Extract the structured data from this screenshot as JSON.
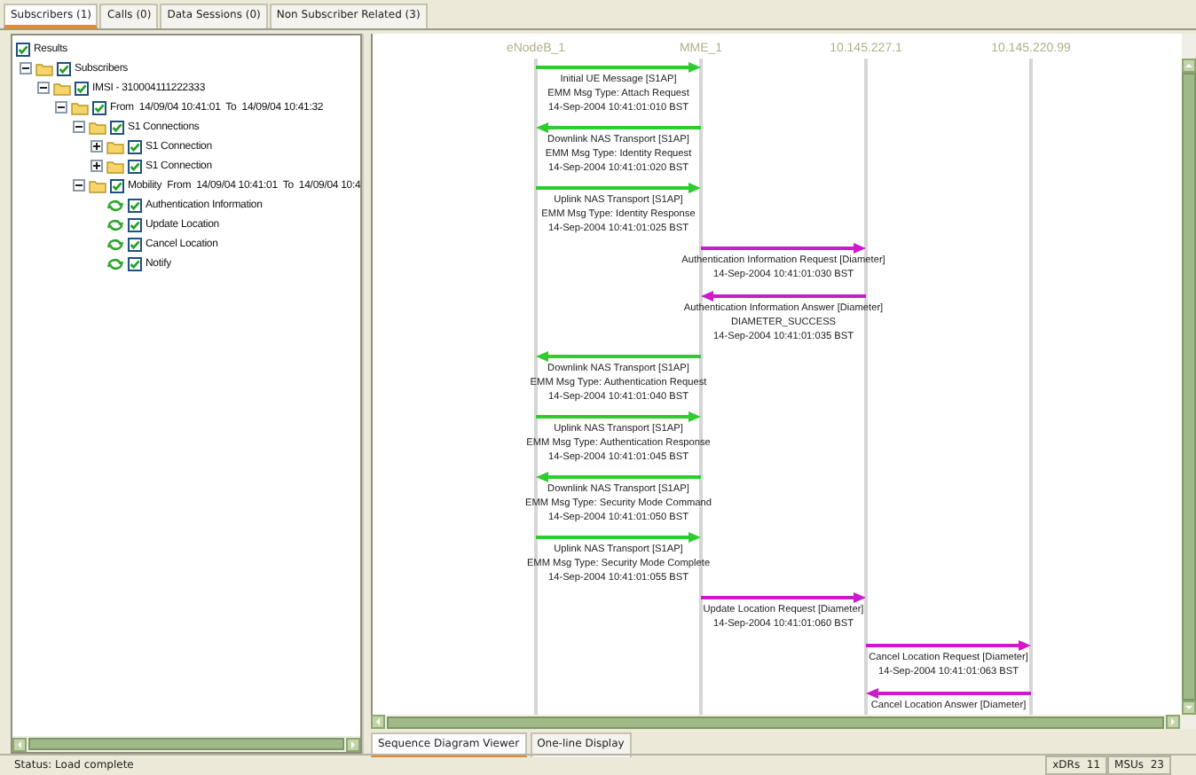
{
  "tabs": [
    {
      "label": "Subscribers (1)",
      "selected": true
    },
    {
      "label": "Calls (0)",
      "selected": false
    },
    {
      "label": "Data Sessions (0)",
      "selected": false
    },
    {
      "label": "Non Subscriber Related (3)",
      "selected": false
    }
  ],
  "tree": [
    {
      "label": "Results",
      "checked": true,
      "children": [
        {
          "label": "Subscribers",
          "kind": "folder",
          "checked": true,
          "expanded": true,
          "children": [
            {
              "label": "IMSI - 310004111222333",
              "kind": "folder",
              "checked": true,
              "expanded": true,
              "children": [
                {
                  "label": "From  14/09/04 10:41:01  To  14/09/04 10:41:32",
                  "kind": "folder",
                  "checked": true,
                  "expanded": true,
                  "children": [
                    {
                      "label": "S1 Connections",
                      "kind": "folder",
                      "checked": true,
                      "expanded": true,
                      "children": [
                        {
                          "label": "S1 Connection",
                          "kind": "folder",
                          "checked": true,
                          "expanded": false
                        },
                        {
                          "label": "S1 Connection",
                          "kind": "folder",
                          "checked": true,
                          "expanded": false
                        }
                      ]
                    },
                    {
                      "label": "Mobility  From  14/09/04 10:41:01  To  14/09/04 10:4",
                      "kind": "folder",
                      "checked": true,
                      "expanded": true,
                      "children": [
                        {
                          "label": "Authentication Information",
                          "kind": "procedure",
                          "checked": true
                        },
                        {
                          "label": "Update Location",
                          "kind": "procedure",
                          "checked": true
                        },
                        {
                          "label": "Cancel Location",
                          "kind": "procedure",
                          "checked": true
                        },
                        {
                          "label": "Notify",
                          "kind": "procedure",
                          "checked": true
                        }
                      ]
                    }
                  ]
                }
              ]
            }
          ]
        }
      ]
    }
  ],
  "lifelines": [
    {
      "name": "eNodeB_1"
    },
    {
      "name": "MME_1"
    },
    {
      "name": "10.145.227.1"
    },
    {
      "name": "10.145.220.99"
    }
  ],
  "messages": [
    {
      "kind": "s1ap_up",
      "lines": [
        "Initial UE Message [S1AP]",
        "EMM Msg Type: Attach Request",
        "14-Sep-2004 10:41:01:010 BST"
      ]
    },
    {
      "kind": "s1ap_down",
      "lines": [
        "Downlink NAS Transport [S1AP]",
        "EMM Msg Type: Identity Request",
        "14-Sep-2004 10:41:01:020 BST"
      ]
    },
    {
      "kind": "s1ap_up",
      "lines": [
        "Uplink NAS Transport [S1AP]",
        "EMM Msg Type: Identity Response",
        "14-Sep-2004 10:41:01:025 BST"
      ]
    },
    {
      "kind": "hss_request",
      "lines": [
        "Authentication Information Request [Diameter]",
        "14-Sep-2004 10:41:01:030 BST"
      ]
    },
    {
      "kind": "hss_answer",
      "lines": [
        "Authentication Information Answer [Diameter]",
        "DIAMETER_SUCCESS",
        "14-Sep-2004 10:41:01:035 BST"
      ]
    },
    {
      "kind": "s1ap_down",
      "lines": [
        "Downlink NAS Transport [S1AP]",
        "EMM Msg Type: Authentication Request",
        "14-Sep-2004 10:41:01:040 BST"
      ]
    },
    {
      "kind": "s1ap_up",
      "lines": [
        "Uplink NAS Transport [S1AP]",
        "EMM Msg Type: Authentication Response",
        "14-Sep-2004 10:41:01:045 BST"
      ]
    },
    {
      "kind": "s1ap_down",
      "lines": [
        "Downlink NAS Transport [S1AP]",
        "EMM Msg Type: Security Mode Command",
        "14-Sep-2004 10:41:01:050 BST"
      ]
    },
    {
      "kind": "s1ap_up",
      "lines": [
        "Uplink NAS Transport [S1AP]",
        "EMM Msg Type: Security Mode Complete",
        "14-Sep-2004 10:41:01:055 BST"
      ]
    },
    {
      "kind": "hss_request",
      "lines": [
        "Update Location Request [Diameter]",
        "14-Sep-2004 10:41:01:060 BST"
      ]
    },
    {
      "kind": "peer_request",
      "lines": [
        "Cancel Location Request [Diameter]",
        "14-Sep-2004 10:41:01:063 BST"
      ]
    },
    {
      "kind": "peer_answer",
      "lines": [
        "Cancel Location Answer [Diameter]"
      ]
    }
  ],
  "view_tabs": [
    {
      "label": "Sequence Diagram Viewer",
      "selected": true
    },
    {
      "label": "One-line Display",
      "selected": false
    }
  ],
  "status_bar": {
    "text": "Status: Load complete",
    "counters": [
      "xDRs  11",
      "MSUs  23"
    ]
  }
}
